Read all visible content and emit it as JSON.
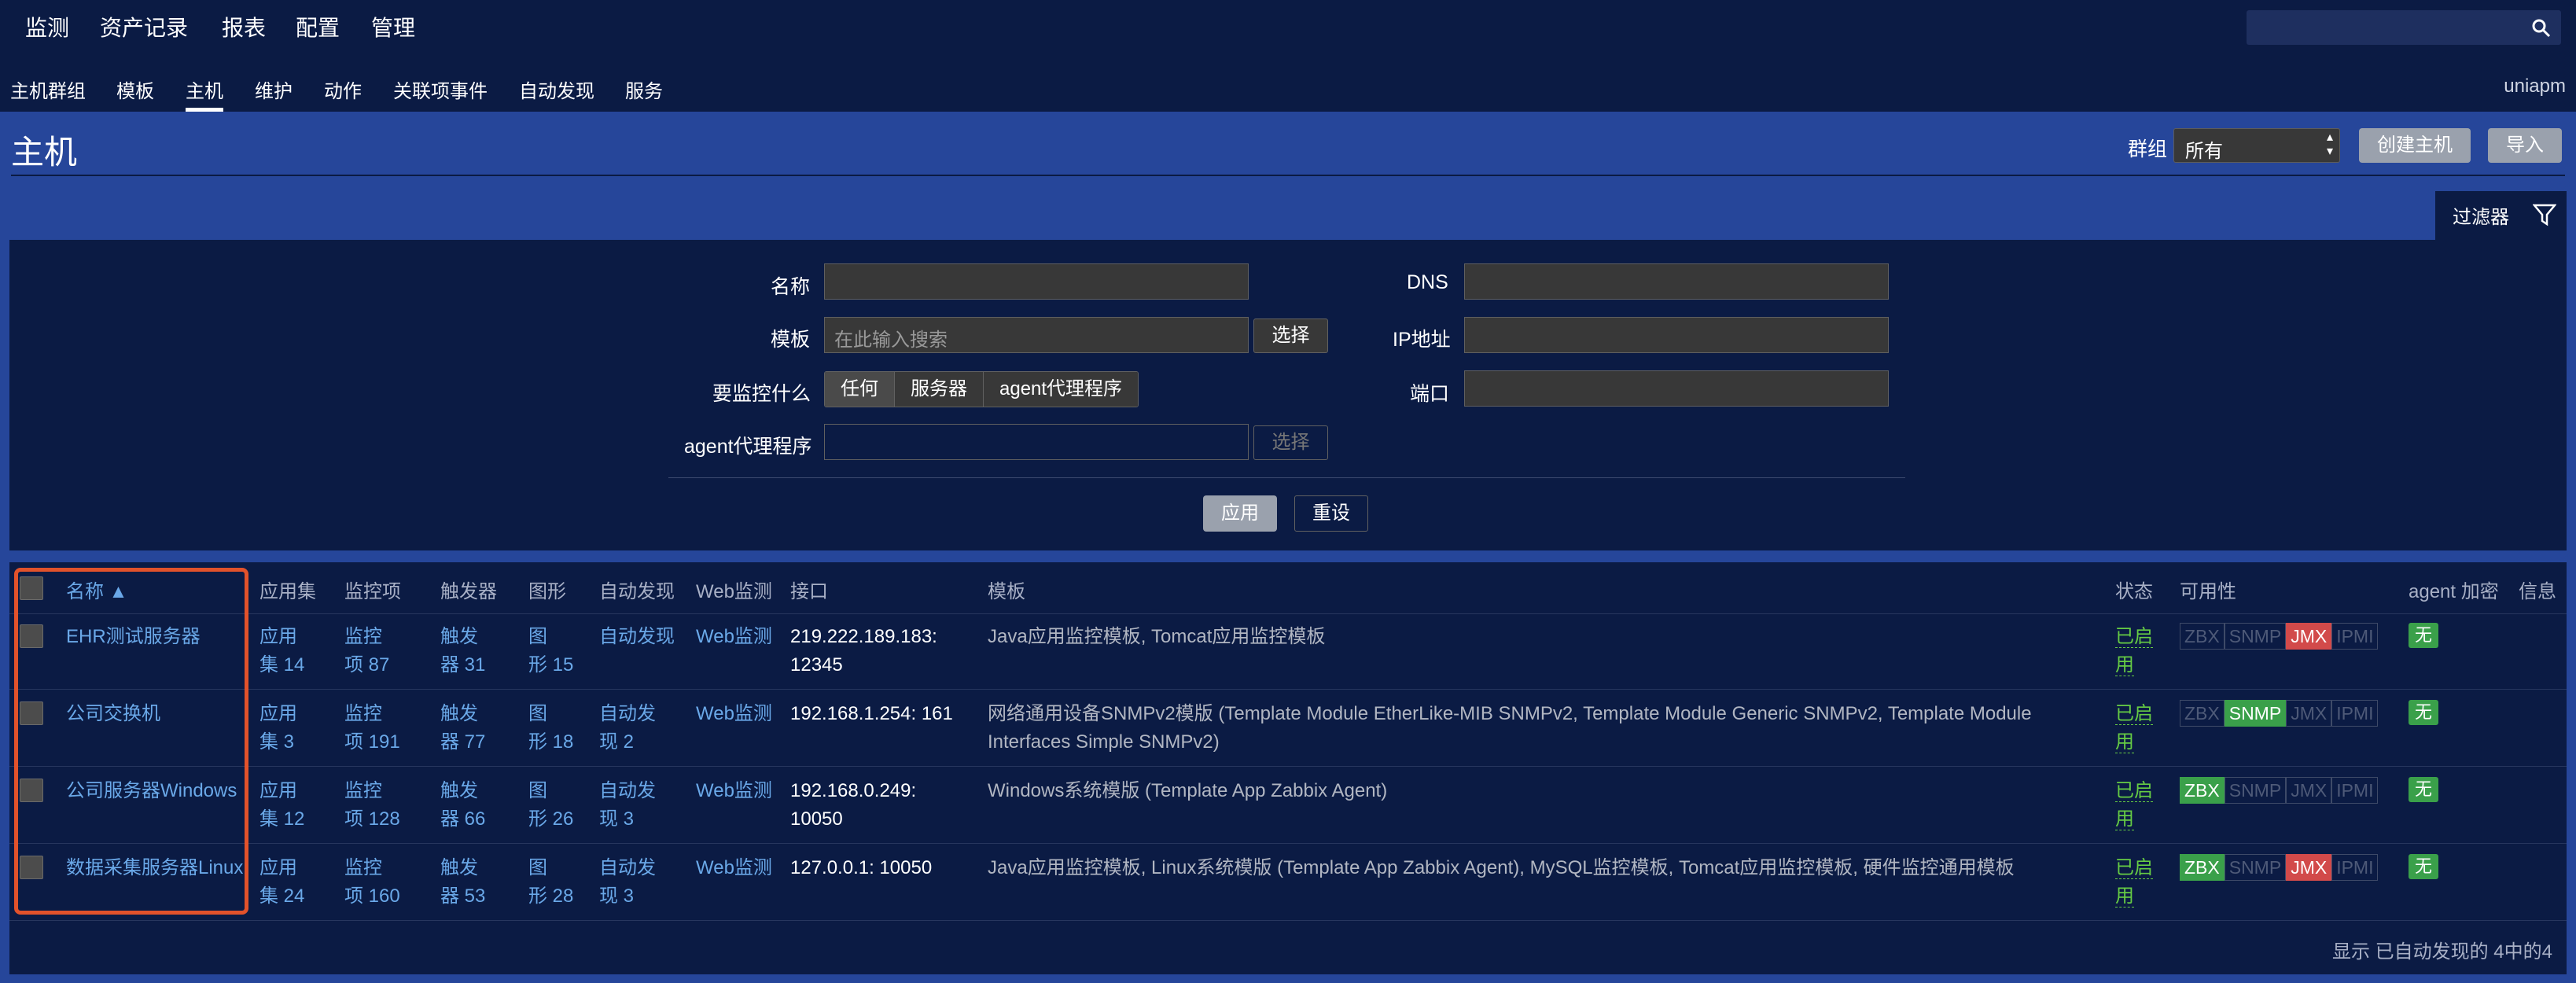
{
  "top_menu": [
    "监测",
    "资产记录",
    "报表",
    "配置",
    "管理"
  ],
  "sub_menu": [
    "主机群组",
    "模板",
    "主机",
    "维护",
    "动作",
    "关联项事件",
    "自动发现",
    "服务"
  ],
  "user": "uniapm",
  "page": {
    "title": "主机",
    "group_label": "群组",
    "group_value": "所有",
    "create": "创建主机",
    "import": "导入"
  },
  "filter": {
    "tab": "过滤器",
    "name_label": "名称",
    "dns_label": "DNS",
    "template_label": "模板",
    "template_placeholder": "在此输入搜索",
    "select": "选择",
    "ip_label": "IP地址",
    "monitor_label": "要监控什么",
    "seg": [
      "任何",
      "服务器",
      "agent代理程序"
    ],
    "port_label": "端口",
    "agent_label": "agent代理程序",
    "apply": "应用",
    "reset": "重设"
  },
  "table": {
    "headers": [
      "名称 ▲",
      "应用集",
      "监控项",
      "触发器",
      "图形",
      "自动发现",
      "Web监测",
      "接口",
      "模板",
      "状态",
      "可用性",
      "agent 加密",
      "信息"
    ],
    "rows": [
      {
        "name": "EHR测试服务器",
        "app": [
          "应用",
          "集 14"
        ],
        "items": [
          "监控",
          "项 87"
        ],
        "trig": [
          "触发",
          "器 31"
        ],
        "graph": [
          "图",
          "形 15"
        ],
        "disc": [
          "自动发现",
          ""
        ],
        "web": "Web监测",
        "iface": [
          "219.222.189.183:",
          "12345"
        ],
        "tmpl1": "Java应用监控模板, Tomcat应用监控模板",
        "tmpl2": "",
        "status": [
          "已启",
          "用"
        ],
        "enc": "无"
      },
      {
        "name": "公司交换机",
        "app": [
          "应用",
          "集 3"
        ],
        "items": [
          "监控",
          "项 191"
        ],
        "trig": [
          "触发",
          "器 77"
        ],
        "graph": [
          "图",
          "形 18"
        ],
        "disc": [
          "自动发",
          "现 2"
        ],
        "web": "Web监测",
        "iface": [
          "192.168.1.254: 161",
          ""
        ],
        "tmpl1": "网络通用设备SNMPv2模版 (Template Module EtherLike-MIB SNMPv2, Template Module Generic SNMPv2, Template Module",
        "tmpl2": "Interfaces Simple SNMPv2)",
        "status": [
          "已启",
          "用"
        ],
        "enc": "无"
      },
      {
        "name": "公司服务器Windows",
        "app": [
          "应用",
          "集 12"
        ],
        "items": [
          "监控",
          "项 128"
        ],
        "trig": [
          "触发",
          "器 66"
        ],
        "graph": [
          "图",
          "形 26"
        ],
        "disc": [
          "自动发",
          "现 3"
        ],
        "web": "Web监测",
        "iface": [
          "192.168.0.249:",
          "10050"
        ],
        "tmpl1": "Windows系统模版 (Template App Zabbix Agent)",
        "tmpl2": "",
        "status": [
          "已启",
          "用"
        ],
        "enc": "无"
      },
      {
        "name": "数据采集服务器Linux",
        "app": [
          "应用",
          "集 24"
        ],
        "items": [
          "监控",
          "项 160"
        ],
        "trig": [
          "触发",
          "器 53"
        ],
        "graph": [
          "图",
          "形 28"
        ],
        "disc": [
          "自动发",
          "现 3"
        ],
        "web": "Web监测",
        "iface": [
          "127.0.0.1: 10050",
          ""
        ],
        "tmpl1": "Java应用监控模板, Linux系统模版 (Template App Zabbix Agent), MySQL监控模板, Tomcat应用监控模板, 硬件监控通用模板",
        "tmpl2": "",
        "status": [
          "已启",
          "用"
        ],
        "enc": "无"
      }
    ],
    "avail_labels": [
      "ZBX",
      "SNMP",
      "JMX",
      "IPMI"
    ],
    "footer": "显示 已自动发现的 4中的4"
  }
}
